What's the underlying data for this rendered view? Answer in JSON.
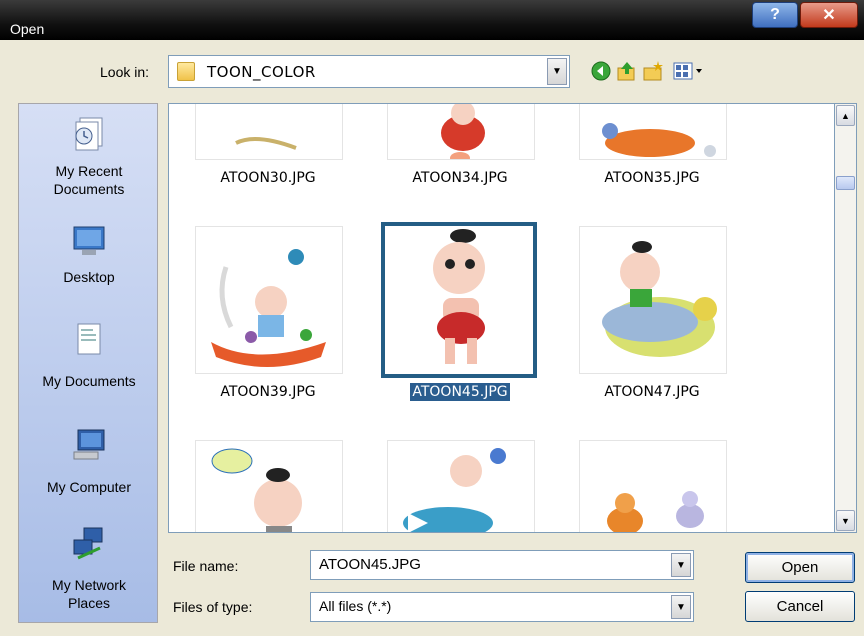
{
  "window": {
    "title": "Open",
    "help_label": "?",
    "close_label": "✕"
  },
  "look_in": {
    "label": "Look in:",
    "value": "TOON_COLOR"
  },
  "toolbar": {
    "icons": [
      "back-icon",
      "up-folder-icon",
      "new-folder-icon",
      "views-menu-icon"
    ]
  },
  "places": [
    {
      "label_lines": [
        "My Recent",
        "Documents"
      ],
      "icon": "recent-documents-icon"
    },
    {
      "label_lines": [
        "Desktop"
      ],
      "icon": "desktop-icon"
    },
    {
      "label_lines": [
        "My Documents"
      ],
      "icon": "my-documents-icon"
    },
    {
      "label_lines": [
        "My Computer"
      ],
      "icon": "my-computer-icon"
    },
    {
      "label_lines": [
        "My Network",
        "Places"
      ],
      "icon": "network-places-icon"
    }
  ],
  "files": [
    {
      "name": "ATOON30.JPG",
      "selected": false
    },
    {
      "name": "ATOON34.JPG",
      "selected": false
    },
    {
      "name": "ATOON35.JPG",
      "selected": false
    },
    {
      "name": "ATOON39.JPG",
      "selected": false
    },
    {
      "name": "ATOON45.JPG",
      "selected": true
    },
    {
      "name": "ATOON47.JPG",
      "selected": false
    }
  ],
  "file_name": {
    "label": "File name:",
    "value": "ATOON45.JPG"
  },
  "file_type": {
    "label": "Files of type:",
    "value": "All files (*.*)"
  },
  "buttons": {
    "open": "Open",
    "cancel": "Cancel"
  },
  "colors": {
    "selection": "#2a5d8f",
    "places_bar": "#a7bce6",
    "title_bar": "#000000"
  }
}
